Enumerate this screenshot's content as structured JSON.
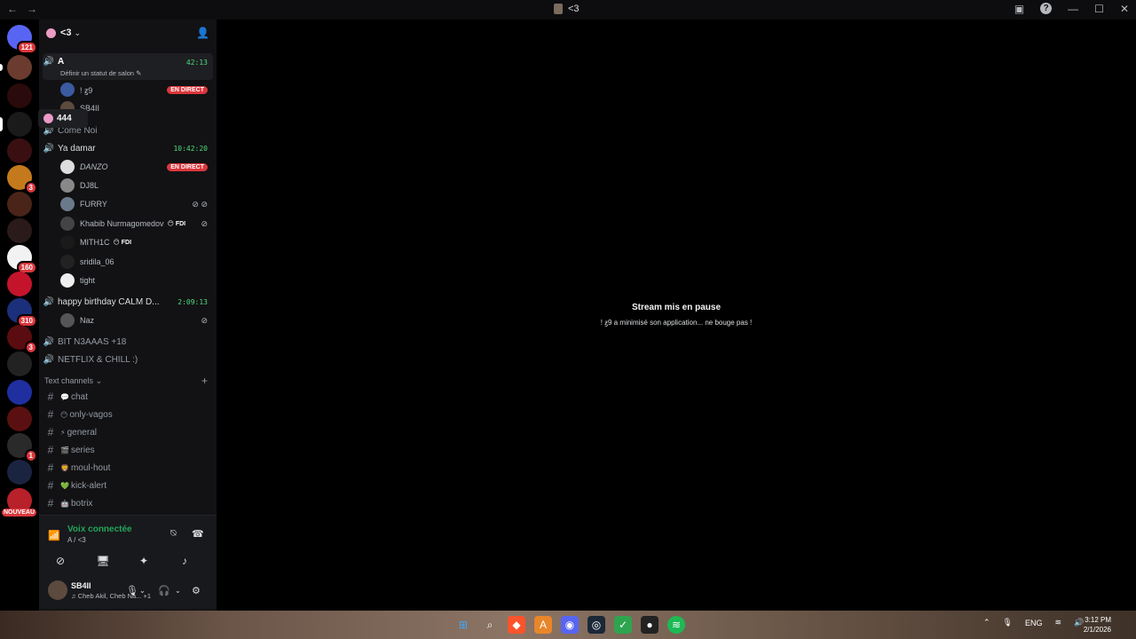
{
  "titlebar": {
    "title": "<3"
  },
  "server": {
    "name": "<3"
  },
  "tooltip": {
    "label": "444"
  },
  "voice_channels": [
    {
      "name": "A",
      "subtitle": "Définir un statut de salon",
      "timer": "42:13"
    },
    {
      "name": "Come Noi"
    },
    {
      "name": "Ya damar",
      "timer": "10:42:20"
    },
    {
      "name": "happy birthday CALM D...",
      "timer": "2:09:13"
    },
    {
      "name": "BIT N3AAAS +18"
    },
    {
      "name": "NETFLIX & CHILL :)"
    }
  ],
  "users": {
    "a": [
      {
        "name": "! ꙃ9",
        "live": "EN DIRECT"
      },
      {
        "name": "SB4II"
      }
    ],
    "ya_damar": [
      {
        "name": "DANZO",
        "live": "EN DIRECT"
      },
      {
        "name": "DJ8L"
      },
      {
        "name": "FURRY"
      },
      {
        "name": "Khabib Nurmagomedov",
        "tag": "FDI"
      },
      {
        "name": "MITH1C",
        "tag": "FDI"
      },
      {
        "name": "sridila_06"
      },
      {
        "name": "tight"
      }
    ],
    "birthday": [
      {
        "name": "Naz"
      }
    ]
  },
  "text_category": "Text channels",
  "text_channels": [
    {
      "emoji": "💬",
      "name": "chat"
    },
    {
      "emoji": "😶",
      "name": "only-vagos"
    },
    {
      "emoji": "⚡",
      "name": "general"
    },
    {
      "emoji": "🎬",
      "name": "series"
    },
    {
      "emoji": "🦁",
      "name": "moul-hout"
    },
    {
      "emoji": "💚",
      "name": "kick-alert"
    },
    {
      "emoji": "🤖",
      "name": "botrix"
    }
  ],
  "guild_badges": [
    "121",
    "3",
    "160",
    "310",
    "3",
    "1",
    "NOUVEAU"
  ],
  "voice_panel": {
    "title": "Voix connectée",
    "subtitle": "A / <3"
  },
  "user_bar": {
    "name": "SB4II",
    "status": "Cheb Akil, Cheb Na...",
    "extra": "+1"
  },
  "stream": {
    "title": "Stream mis en pause",
    "subtitle": "! ꙃ9 a minimisé son application... ne bouge pas !"
  },
  "tray": {
    "lang": "ENG"
  },
  "clock": {
    "time": "3:12 PM",
    "date": "2/1/2026"
  },
  "colors": {
    "live": "#da373c",
    "connected": "#23a559",
    "timer": "#4fdc7c"
  }
}
